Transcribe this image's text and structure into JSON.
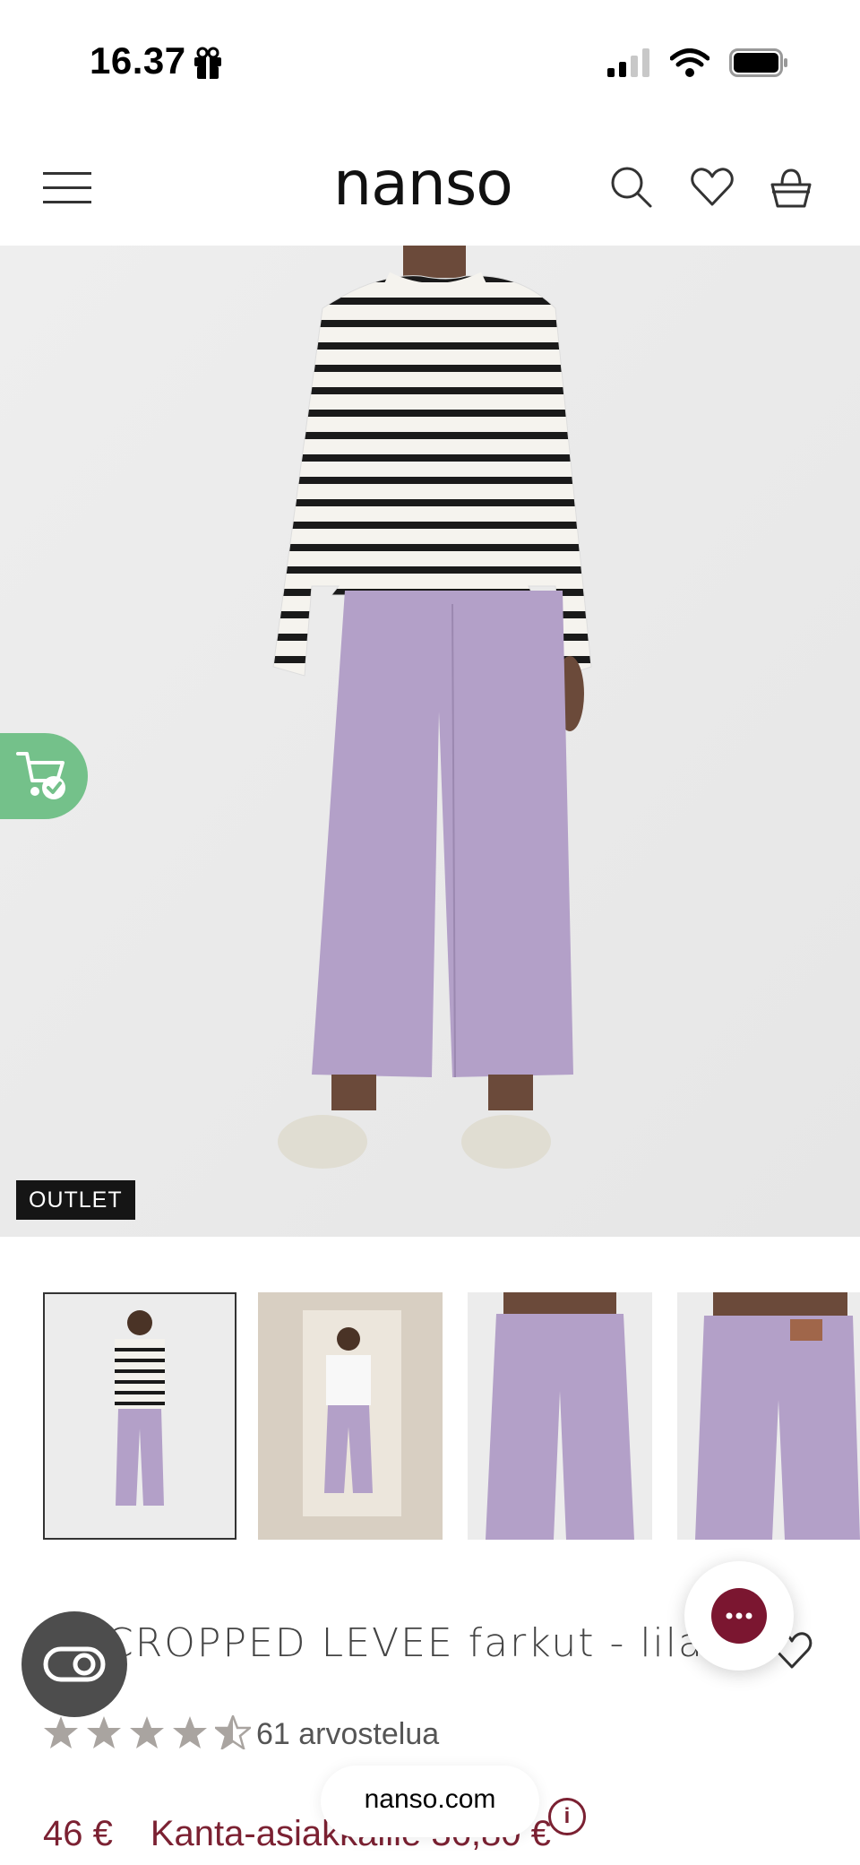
{
  "status_bar": {
    "time": "16.37"
  },
  "header": {
    "logo": "nanso"
  },
  "hero": {
    "badge": "OUTLET"
  },
  "product": {
    "title": "CROPPED LEVEE farkut - lila",
    "rating_value": 4.5,
    "rating_max": 5,
    "reviews": "61 arvostelua",
    "price": "46 €",
    "member_price": "Kanta-asiakkaille 36,80 €"
  },
  "browser": {
    "url": "nanso.com"
  },
  "colors": {
    "accent": "#7b2132",
    "cart_tab": "#74c18a",
    "outlet_badge": "#151515"
  }
}
